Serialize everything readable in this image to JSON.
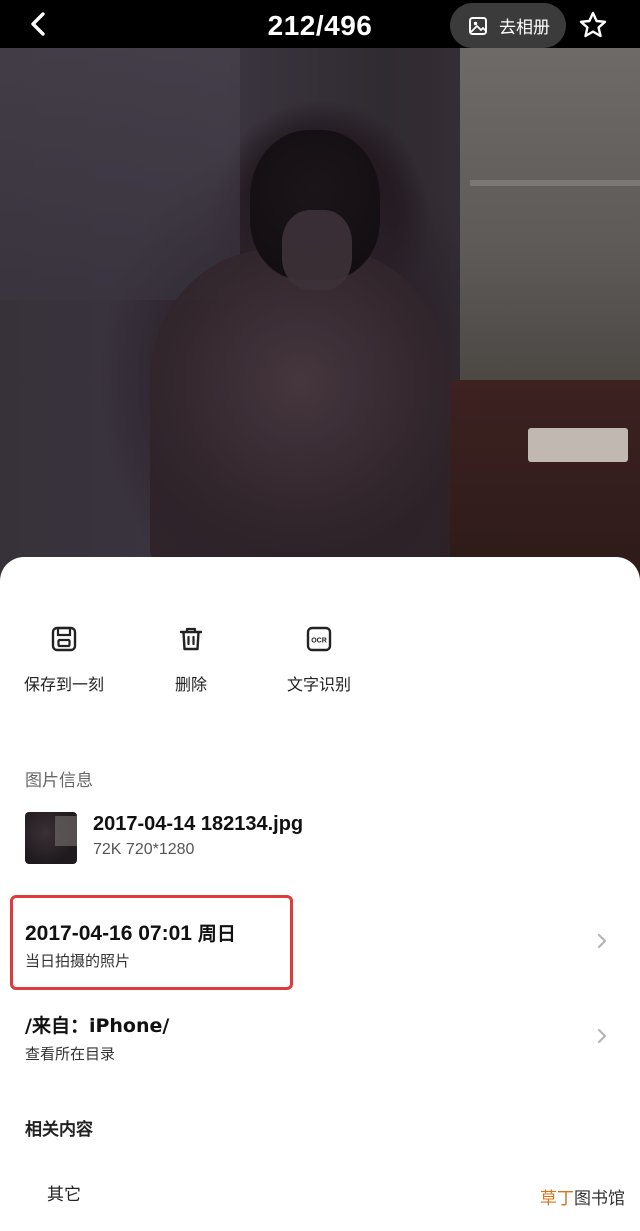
{
  "header": {
    "counter": "212/496",
    "album_button_label": "去相册",
    "icons": {
      "back": "back-chevron-icon",
      "album": "image-icon",
      "favorite": "star-icon"
    }
  },
  "actions": [
    {
      "label": "保存到一刻",
      "icon": "save-icon"
    },
    {
      "label": "删除",
      "icon": "trash-icon"
    },
    {
      "label": "文字识别",
      "icon": "ocr-icon",
      "icon_text": "OCR"
    }
  ],
  "info": {
    "section_title": "图片信息",
    "file_name": "2017-04-14 182134.jpg",
    "file_meta": "72K 720*1280",
    "date_row": {
      "date_time": "2017-04-16 07:01",
      "weekday": "周日",
      "subtitle": "当日拍摄的照片"
    },
    "source_row": {
      "title": "/来自：iPhone/",
      "subtitle": "查看所在目录"
    }
  },
  "related": {
    "section_title": "相关内容",
    "tag": "其它"
  },
  "watermark": {
    "accent": "草丁",
    "rest": "图书馆"
  },
  "colors": {
    "highlight_border": "#e03a3a",
    "watermark_accent": "#d8741c",
    "album_button_bg": "#3b3b3b"
  }
}
